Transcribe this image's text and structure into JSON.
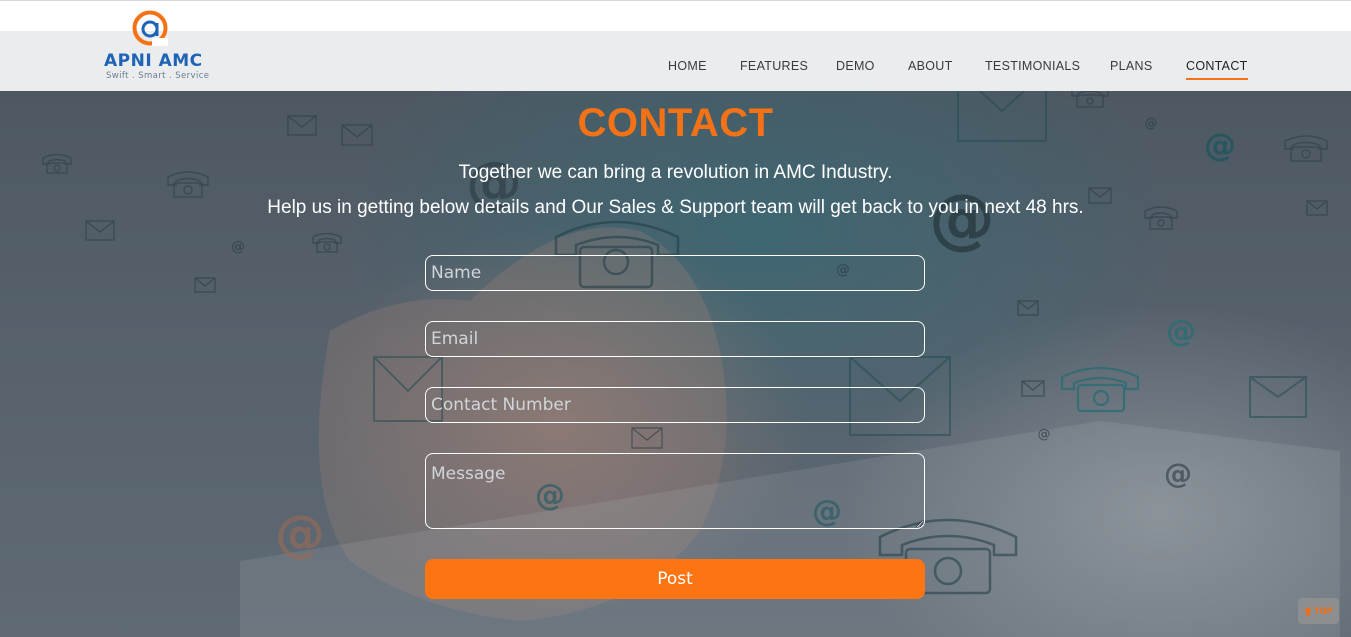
{
  "brand": {
    "name": "APNI AMC",
    "tagline": "Swift . Smart . Service",
    "mark_color": "#f47216",
    "text_color": "#1f63b6"
  },
  "nav": {
    "items": [
      {
        "label": "HOME"
      },
      {
        "label": "FEATURES"
      },
      {
        "label": "DEMO"
      },
      {
        "label": "ABOUT"
      },
      {
        "label": "TESTIMONIALS"
      },
      {
        "label": "PLANS"
      },
      {
        "label": "CONTACT",
        "active": true
      }
    ],
    "active_underline_color": "#f47216"
  },
  "contact": {
    "title": "CONTACT",
    "subtitle_1": "Together we can bring a revolution in AMC Industry.",
    "subtitle_2": "Help us in getting below details and Our Sales & Support team will get back to you in next 48 hrs.",
    "form": {
      "name_placeholder": "Name",
      "email_placeholder": "Email",
      "phone_placeholder": "Contact Number",
      "message_placeholder": "Message",
      "submit_label": "Post"
    }
  },
  "scroll_top": {
    "label": "TOP",
    "icon": "arrow-up-icon"
  },
  "colors": {
    "accent": "#f47216",
    "button": "#fd7512",
    "header_bg": "#eaeced",
    "hero_overlay": "#56616c"
  }
}
